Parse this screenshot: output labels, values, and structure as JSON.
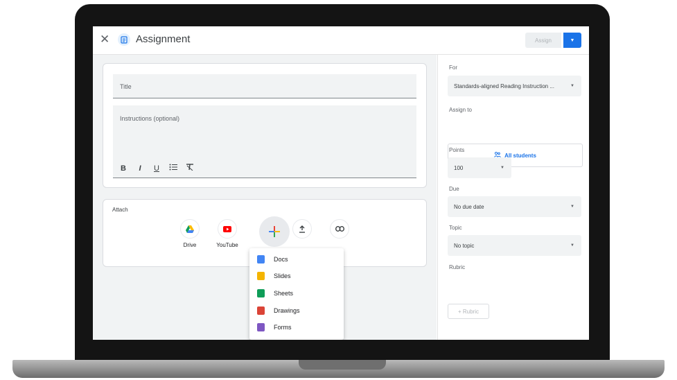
{
  "header": {
    "close_icon": "close-icon",
    "title": "Assignment",
    "assign_label": "Assign"
  },
  "form": {
    "title_placeholder": "Title",
    "instructions_placeholder": "Instructions (optional)",
    "format": [
      "B",
      "I",
      "U"
    ]
  },
  "attach": {
    "label": "Attach",
    "items": [
      {
        "label": "Drive",
        "icon": "drive-icon"
      },
      {
        "label": "YouTube",
        "icon": "youtube-icon"
      },
      {
        "label": "",
        "icon": "add-icon"
      },
      {
        "label": "",
        "icon": "upload-icon"
      },
      {
        "label": "",
        "icon": "link-icon"
      }
    ]
  },
  "create_menu": {
    "items": [
      {
        "label": "Docs",
        "color": "#4285f4"
      },
      {
        "label": "Slides",
        "color": "#f4b400"
      },
      {
        "label": "Sheets",
        "color": "#0f9d58"
      },
      {
        "label": "Drawings",
        "color": "#db4437"
      },
      {
        "label": "Forms",
        "color": "#7e57c2"
      }
    ]
  },
  "sidebar": {
    "for_label": "For",
    "for_value": "Standards-aligned Reading Instruction ...",
    "assign_to_label": "Assign to",
    "assign_to_value": "All students",
    "points_label": "Points",
    "points_value": "100",
    "due_label": "Due",
    "due_value": "No due date",
    "topic_label": "Topic",
    "topic_value": "No topic",
    "rubric_label": "Rubric",
    "rubric_button": "+ Rubric"
  },
  "colors": {
    "accent": "#1a73e8"
  }
}
